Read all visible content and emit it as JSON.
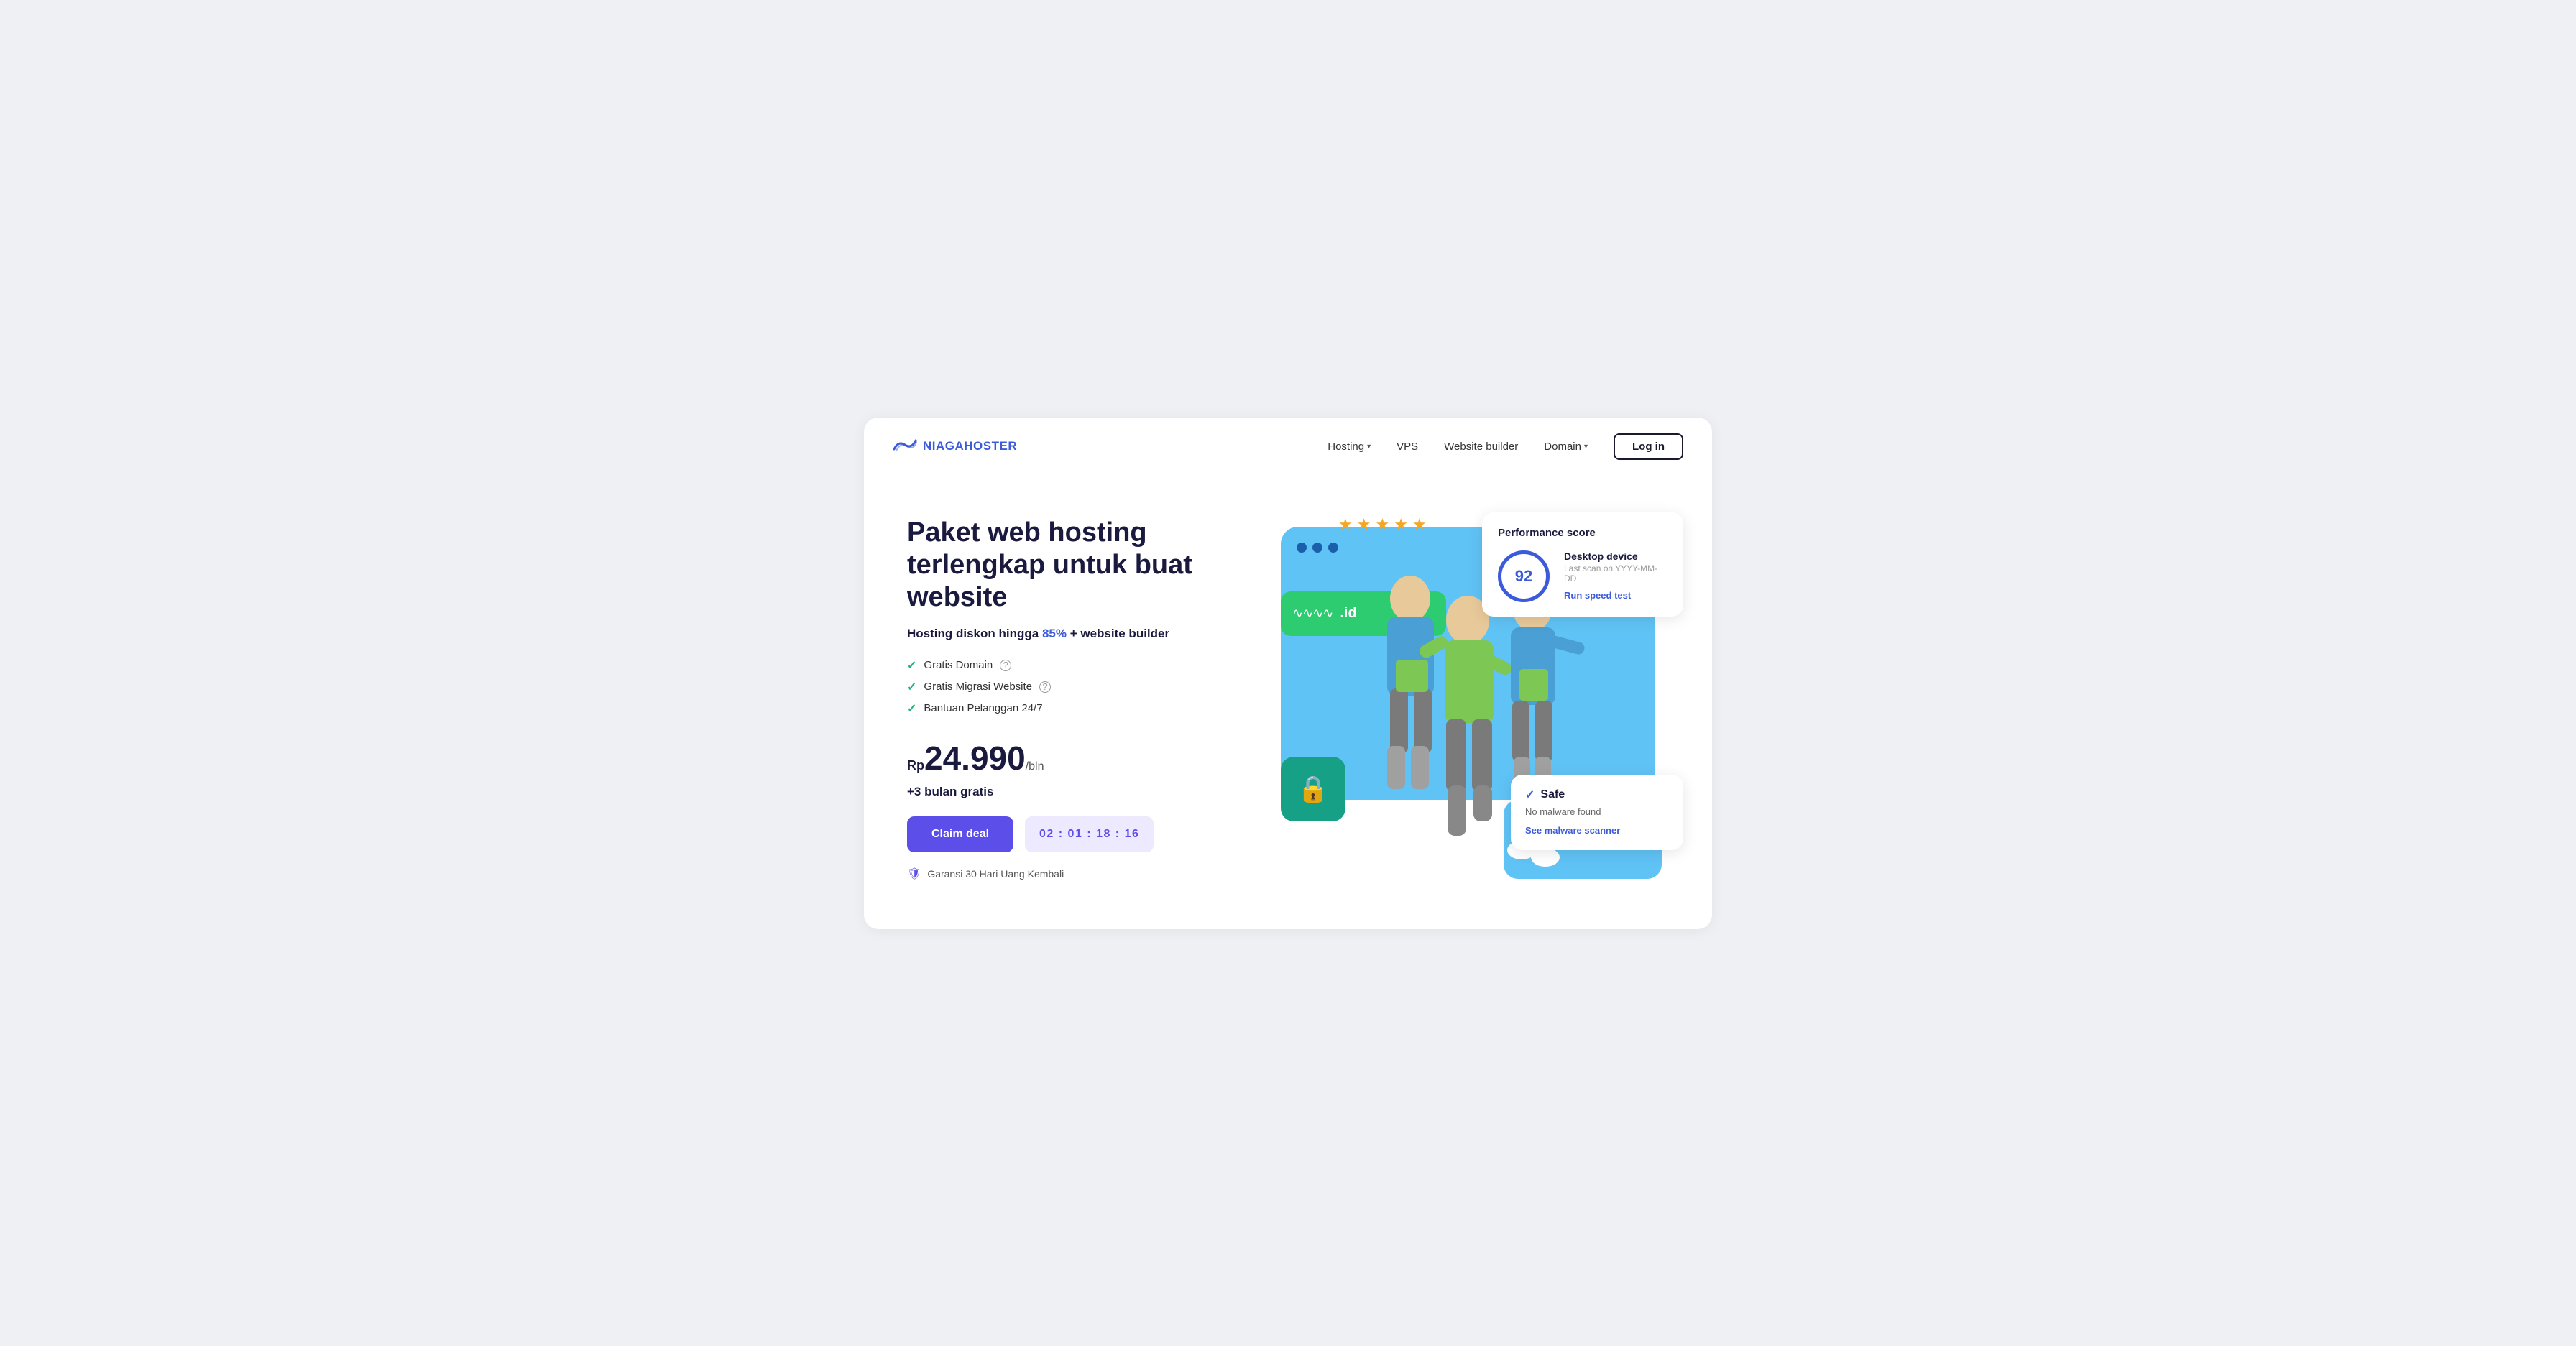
{
  "brand": {
    "name": "NIAGAHOSTER",
    "logo_alt": "NiagaHoster logo"
  },
  "nav": {
    "links": [
      {
        "label": "Hosting",
        "has_dropdown": true
      },
      {
        "label": "VPS",
        "has_dropdown": false
      },
      {
        "label": "Website builder",
        "has_dropdown": false
      },
      {
        "label": "Domain",
        "has_dropdown": true
      }
    ],
    "cta_label": "Log in"
  },
  "hero": {
    "title": "Paket web hosting terlengkap untuk buat website",
    "subtitle_prefix": "Hosting diskon hingga ",
    "subtitle_highlight": "85%",
    "subtitle_suffix": " + website builder",
    "features": [
      {
        "text": "Gratis Domain",
        "has_info": true
      },
      {
        "text": "Gratis Migrasi Website",
        "has_info": true
      },
      {
        "text": "Bantuan Pelanggan 24/7",
        "has_info": false
      }
    ],
    "price_currency": "Rp",
    "price_amount": "24.990",
    "price_period": "/bln",
    "price_bonus": "+3 bulan gratis",
    "cta_label": "Claim deal",
    "timer": "02 : 01 : 18 : 16",
    "guarantee": "Garansi 30 Hari Uang Kembali"
  },
  "illustration": {
    "stars": [
      "★",
      "★",
      "★",
      "★",
      "★"
    ],
    "domain_wave": "∿∿∿∿",
    "domain_tld": ".id"
  },
  "performance_card": {
    "title": "Performance score",
    "score": "92",
    "device": "Desktop device",
    "last_scan": "Last scan on YYYY-MM-DD",
    "cta": "Run speed test"
  },
  "safe_card": {
    "title": "Safe",
    "description": "No malware found",
    "cta": "See malware scanner"
  }
}
